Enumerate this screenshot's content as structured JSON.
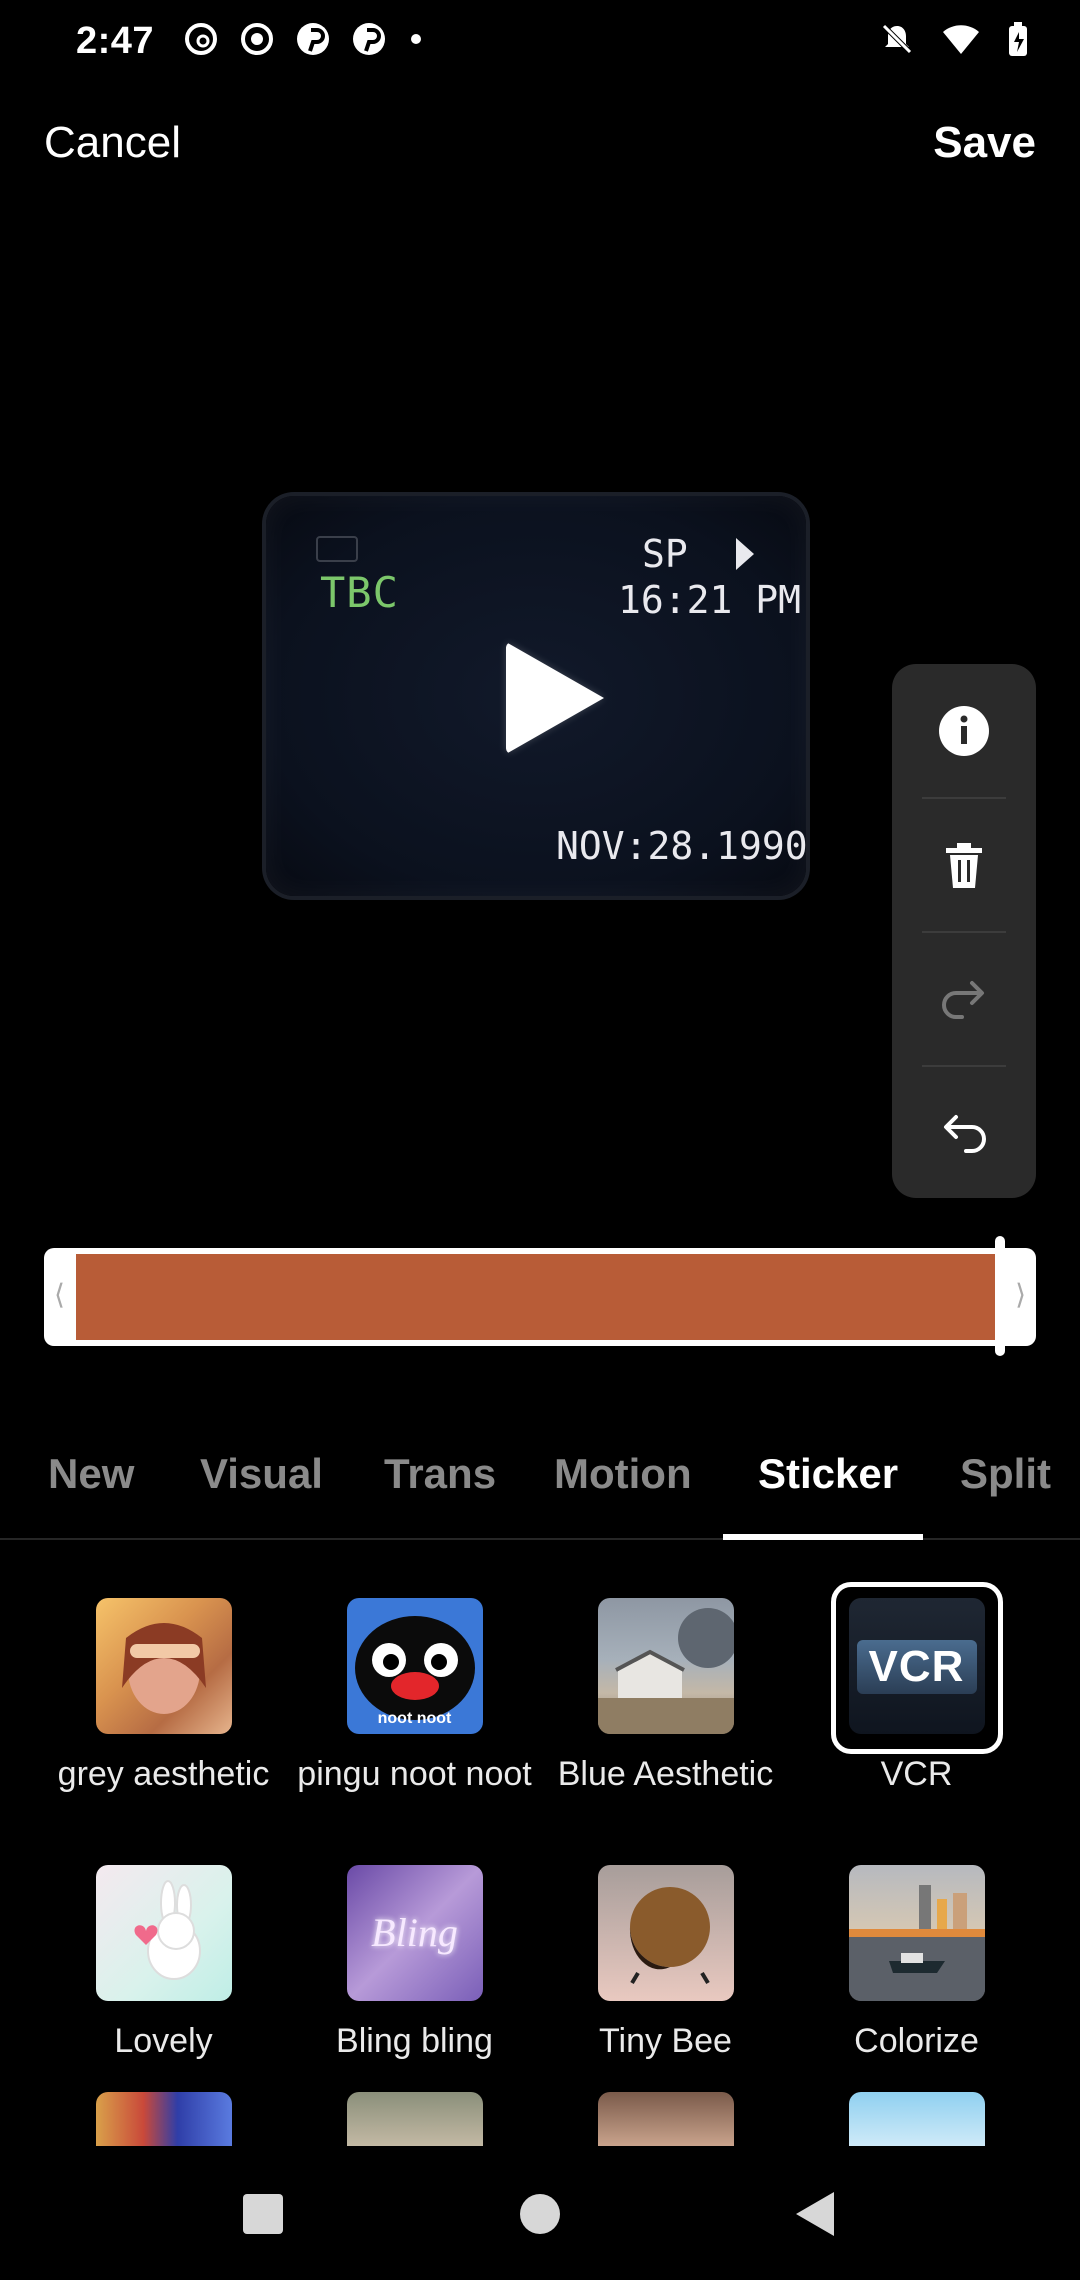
{
  "status_bar": {
    "time": "2:47"
  },
  "header": {
    "cancel_label": "Cancel",
    "save_label": "Save"
  },
  "video": {
    "tbc_text": "TBC",
    "sp_text": "SP",
    "clock_text": "16:21 PM",
    "date_text": "NOV:28.1990"
  },
  "tabs": [
    {
      "label": "New"
    },
    {
      "label": "Visual"
    },
    {
      "label": "Trans"
    },
    {
      "label": "Motion"
    },
    {
      "label": "Sticker"
    },
    {
      "label": "Split"
    }
  ],
  "active_tab": "Sticker",
  "stickers": [
    {
      "label": "grey aesthetic"
    },
    {
      "label": "pingu noot noot",
      "thumb_text": "noot noot"
    },
    {
      "label": "Blue Aesthetic"
    },
    {
      "label": "VCR",
      "thumb_text": "VCR",
      "selected": true
    },
    {
      "label": "Lovely"
    },
    {
      "label": "Bling bling",
      "thumb_text": "Bling"
    },
    {
      "label": "Tiny Bee"
    },
    {
      "label": "Colorize"
    }
  ],
  "colors": {
    "timeline_clip": "#b85c37",
    "tool_panel_bg": "#2a2a2a"
  },
  "icons": {
    "status_left": [
      "threads-icon",
      "record-icon",
      "pinterest-icon",
      "pinterest-icon",
      "dot-icon"
    ],
    "status_right": [
      "notifications-off-icon",
      "wifi-icon",
      "battery-charging-icon"
    ],
    "tools": [
      "info-icon",
      "trash-icon",
      "redo-icon",
      "undo-icon"
    ]
  }
}
